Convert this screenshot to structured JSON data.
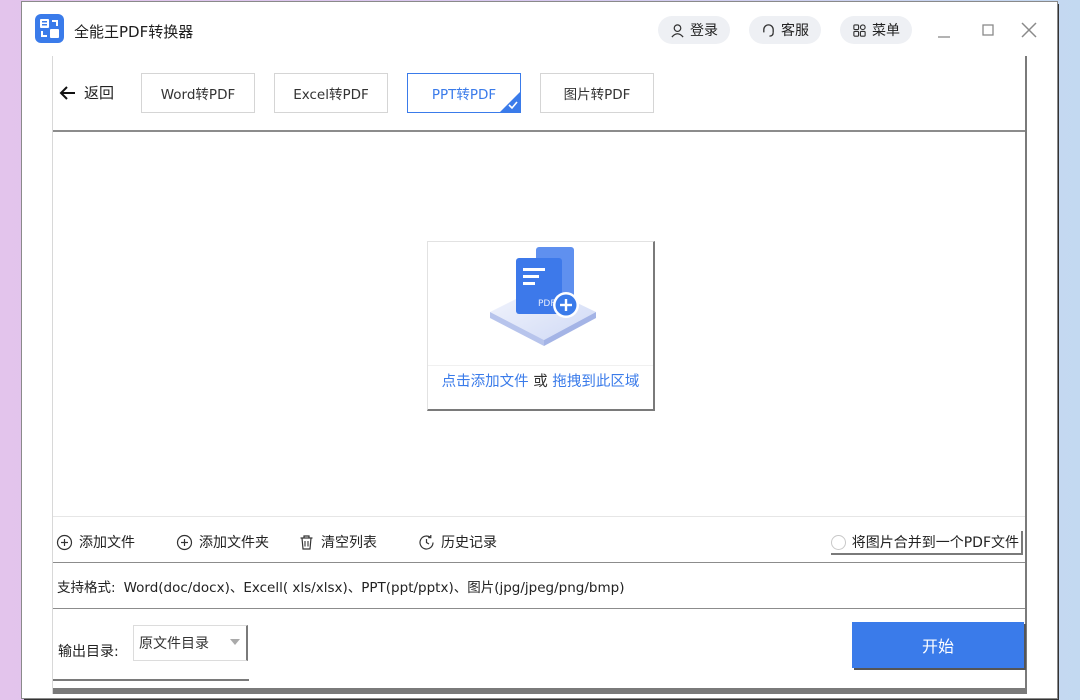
{
  "app": {
    "title": "全能王PDF转换器"
  },
  "header": {
    "login_label": "登录",
    "service_label": "客服",
    "menu_label": "菜单"
  },
  "nav": {
    "back_label": "返回",
    "tabs": [
      {
        "label": "Word转PDF",
        "active": false
      },
      {
        "label": "Excel转PDF",
        "active": false
      },
      {
        "label": "PPT转PDF",
        "active": true
      },
      {
        "label": "图片转PDF",
        "active": false
      }
    ]
  },
  "dropzone": {
    "click_text": "点击添加文件",
    "or_text": " 或 ",
    "drag_text": "拖拽到此区域",
    "badge_text": "PDF"
  },
  "toolbar": {
    "add_file": "添加文件",
    "add_folder": "添加文件夹",
    "clear_list": "清空列表",
    "history": "历史记录",
    "merge_label": "将图片合并到一个PDF文件",
    "merge_checked": false
  },
  "support": {
    "label": "支持格式:",
    "formats": "Word(doc/docx)、Excell( xls/xlsx)、PPT(ppt/pptx)、图片(jpg/jpeg/png/bmp)"
  },
  "output": {
    "label": "输出目录:",
    "selected": "原文件目录"
  },
  "start_label": "开始",
  "colors": {
    "accent": "#3a7bea"
  }
}
